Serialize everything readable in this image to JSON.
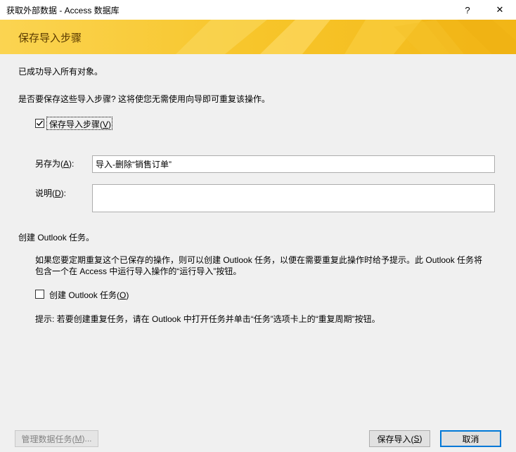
{
  "window": {
    "title": "获取外部数据 - Access 数据库",
    "help_glyph": "?",
    "close_glyph": "✕"
  },
  "banner": {
    "title": "保存导入步骤"
  },
  "main": {
    "success_message": "已成功导入所有对象。",
    "save_question": "是否要保存这些导入步骤? 这将使您无需使用向导即可重复该操作。",
    "save_steps_checkbox": {
      "label_prefix": "保存导入步骤(",
      "accesskey": "V",
      "label_suffix": ")",
      "checked": true
    },
    "save_as": {
      "label_prefix": "另存为(",
      "accesskey": "A",
      "label_suffix": "):",
      "value": "导入-删除“销售订单”"
    },
    "description": {
      "label_prefix": "说明(",
      "accesskey": "D",
      "label_suffix": "):",
      "value": ""
    },
    "outlook_section_title": "创建 Outlook 任务。",
    "outlook_desc_line1": "如果您要定期重复这个已保存的操作，则可以创建 Outlook 任务，以便在需要重复此操作时给予提示。此 Outlook 任务将",
    "outlook_desc_line2": "包含一个在 Access 中运行导入操作的“运行导入”按钮。",
    "outlook_checkbox": {
      "label_prefix": "创建 Outlook 任务(",
      "accesskey": "O",
      "label_suffix": ")",
      "checked": false
    },
    "hint": "提示: 若要创建重复任务，请在 Outlook 中打开任务并单击“任务”选项卡上的“重复周期”按钮。"
  },
  "footer": {
    "manage_button": {
      "label_prefix": "管理数据任务(",
      "accesskey": "M",
      "label_suffix": ")...",
      "enabled": false
    },
    "save_import_button": {
      "label_prefix": "保存导入(",
      "accesskey": "S",
      "label_suffix": ")"
    },
    "cancel_button": {
      "label": "取消"
    }
  },
  "colors": {
    "banner_accent": "#f6c22c",
    "default_button_border": "#0078d7"
  }
}
